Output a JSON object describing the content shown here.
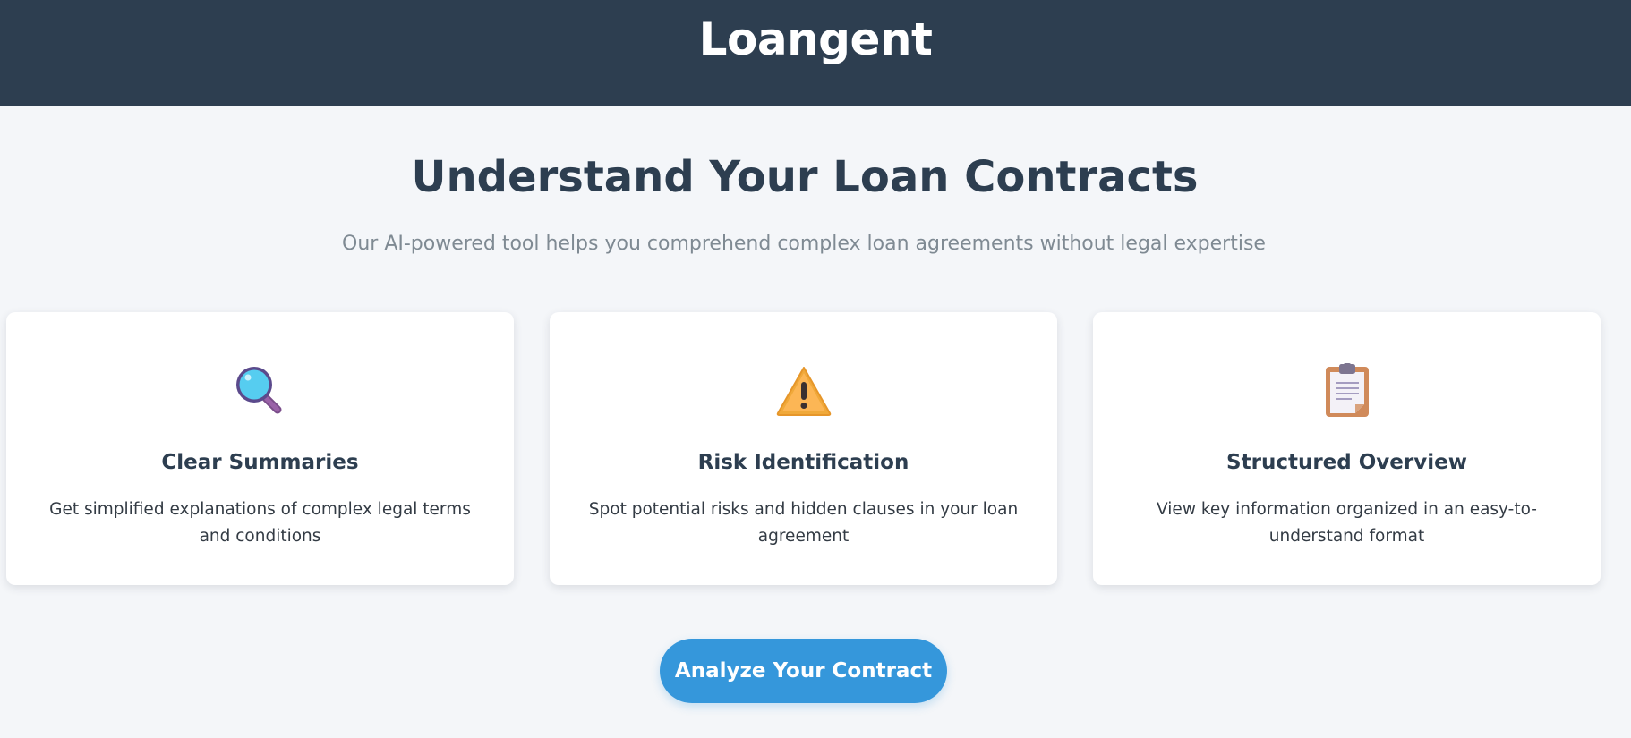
{
  "header": {
    "brand": "Loangent"
  },
  "hero": {
    "title": "Understand Your Loan Contracts",
    "subtitle": "Our AI-powered tool helps you comprehend complex loan agreements without legal expertise"
  },
  "features": [
    {
      "icon": "magnifying-glass-icon",
      "title": "Clear Summaries",
      "description": "Get simplified explanations of complex legal terms and conditions"
    },
    {
      "icon": "warning-icon",
      "title": "Risk Identification",
      "description": "Spot potential risks and hidden clauses in your loan agreement"
    },
    {
      "icon": "clipboard-icon",
      "title": "Structured Overview",
      "description": "View key information organized in an easy-to-understand format"
    }
  ],
  "cta": {
    "label": "Analyze Your Contract"
  },
  "colors": {
    "header_bg": "#2d3e50",
    "page_bg": "#f4f6f9",
    "accent": "#3597db",
    "subtitle": "#7f8a93"
  }
}
